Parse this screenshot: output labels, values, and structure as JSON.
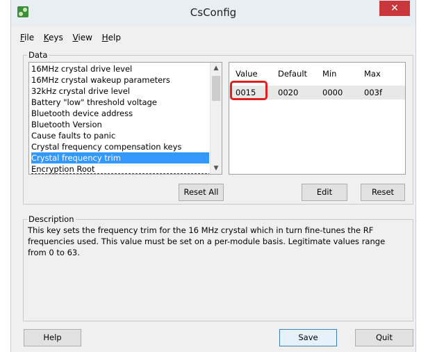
{
  "window": {
    "title": "CsConfig",
    "close_label": "✕"
  },
  "menu": [
    {
      "label": "File",
      "accel": "F",
      "rest": "ile"
    },
    {
      "label": "Keys",
      "accel": "K",
      "rest": "eys"
    },
    {
      "label": "View",
      "accel": "V",
      "rest": "iew"
    },
    {
      "label": "Help",
      "accel": "H",
      "rest": "elp"
    }
  ],
  "data_group": {
    "label": "Data",
    "items": [
      "16MHz crystal drive level",
      "16MHz crystal wakeup parameters",
      "32kHz crystal drive level",
      "Battery \"low\" threshold voltage",
      "Bluetooth device address",
      "Bluetooth Version",
      "Cause faults to panic",
      "Crystal frequency compensation keys",
      "Crystal frequency trim",
      "Encryption Root"
    ],
    "selected_index": 8
  },
  "value_table": {
    "headers": [
      "Value",
      "Default",
      "Min",
      "Max"
    ],
    "row": [
      "0015",
      "0020",
      "0000",
      "003f"
    ]
  },
  "buttons": {
    "reset_all": "Reset All",
    "edit": "Edit",
    "reset": "Reset",
    "help": "Help",
    "save": "Save",
    "quit": "Quit"
  },
  "description": {
    "label": "Description",
    "text": "This key sets the frequency trim for the 16 MHz crystal which in turn fine-tunes the RF frequencies used.  This value must be set on a per-module basis.  Legitimate values range from 0 to 63."
  },
  "colors": {
    "selection": "#3399ff",
    "highlight": "#e0201f",
    "close": "#c7373b"
  }
}
